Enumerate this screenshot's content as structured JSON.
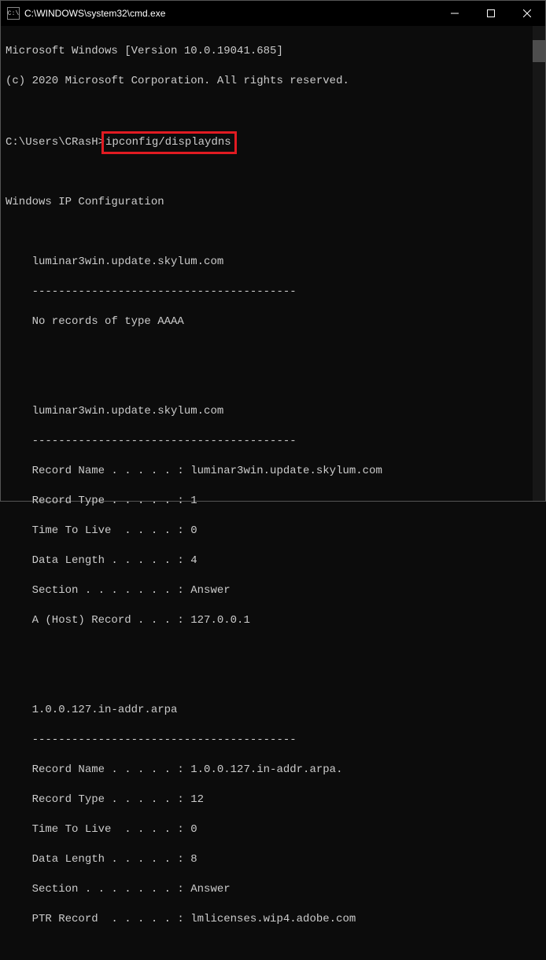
{
  "titlebar": {
    "title": "C:\\WINDOWS\\system32\\cmd.exe"
  },
  "terminal": {
    "line1": "Microsoft Windows [Version 10.0.19041.685]",
    "line2": "(c) 2020 Microsoft Corporation. All rights reserved.",
    "prompt_prefix": "C:\\Users\\CRasH>",
    "command": "ipconfig/displaydns",
    "heading": "Windows IP Configuration",
    "entry1_host": "    luminar3win.update.skylum.com",
    "entry1_divider": "    ----------------------------------------",
    "entry1_msg": "    No records of type AAAA",
    "entry2_host": "    luminar3win.update.skylum.com",
    "entry2_divider": "    ----------------------------------------",
    "entry2_f1": "    Record Name . . . . . : luminar3win.update.skylum.com",
    "entry2_f2": "    Record Type . . . . . : 1",
    "entry2_f3": "    Time To Live  . . . . : 0",
    "entry2_f4": "    Data Length . . . . . : 4",
    "entry2_f5": "    Section . . . . . . . : Answer",
    "entry2_f6": "    A (Host) Record . . . : 127.0.0.1",
    "entry3_host": "    1.0.0.127.in-addr.arpa",
    "entry3_divider": "    ----------------------------------------",
    "entry3_f1": "    Record Name . . . . . : 1.0.0.127.in-addr.arpa.",
    "entry3_f2": "    Record Type . . . . . : 12",
    "entry3_f3": "    Time To Live  . . . . : 0",
    "entry3_f4": "    Data Length . . . . . : 8",
    "entry3_f5": "    Section . . . . . . . : Answer",
    "entry3_f6": "    PTR Record  . . . . . : lmlicenses.wip4.adobe.com"
  }
}
